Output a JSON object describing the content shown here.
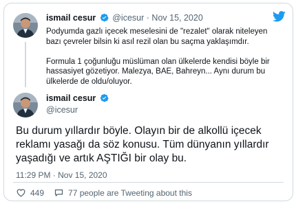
{
  "parent_tweet": {
    "author_name": "ismail cesur",
    "handle": "@icesur",
    "separator": "·",
    "date": "Nov 15, 2020",
    "paragraphs": [
      "Podyumda gazlı içecek meselesini de \"rezalet\" olarak niteleyen bazı çevreler bilsin ki asıl rezil olan bu saçma yaklaşımdır.",
      "Formula 1 çoğunluğu müslüman olan ülkelerde kendisi böyle bir hassasiyet gözetiyor. Malezya, BAE, Bahreyn... Aynı durum bu ülkelerde de oldu/oluyor."
    ]
  },
  "main_tweet": {
    "author_name": "ismail cesur",
    "handle": "@icesur",
    "paragraphs": [
      "Bu durum yıllardır böyle. Olayın bir de alkollü içecek reklamı yasağı da söz konusu. Tüm dünyanın yıllardır yaşadığı ve artık AŞTIĞI bir olay bu."
    ],
    "timestamp": "11:29 PM · Nov 15, 2020",
    "likes": "449",
    "tweeting_text": "77 people are Tweeting about this"
  },
  "colors": {
    "accent": "#1d9bf0",
    "text": "#0f1419",
    "muted": "#536471",
    "border": "#cfd9de"
  },
  "icons": {
    "brand": "twitter-bird-icon",
    "verified": "verified-badge-icon",
    "like": "heart-icon",
    "reply": "speech-bubble-icon"
  }
}
